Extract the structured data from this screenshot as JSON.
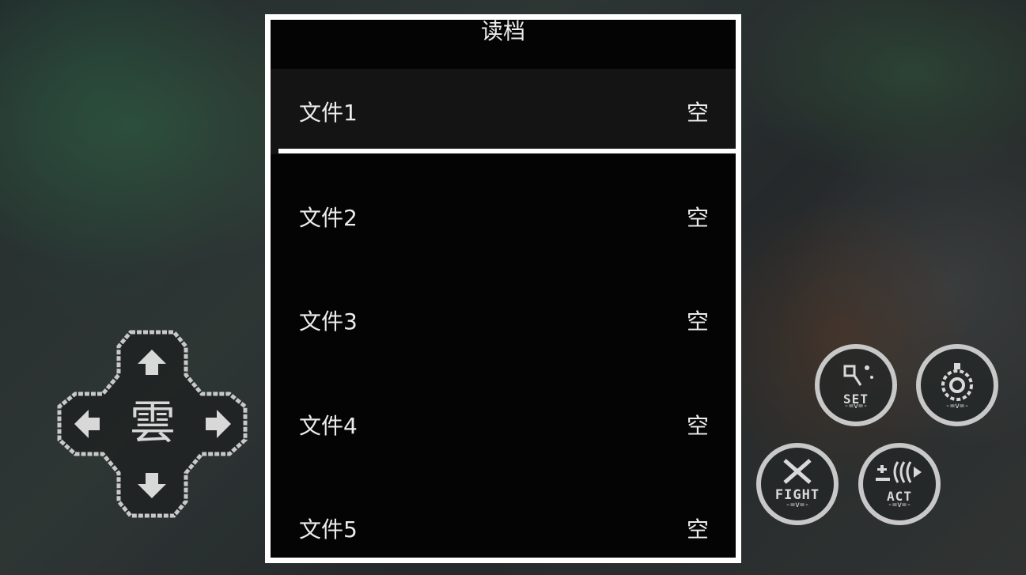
{
  "dialog": {
    "title": "读档",
    "slots": [
      {
        "name": "文件1",
        "status": "空",
        "selected": true
      },
      {
        "name": "文件2",
        "status": "空"
      },
      {
        "name": "文件3",
        "status": "空"
      },
      {
        "name": "文件4",
        "status": "空"
      },
      {
        "name": "文件5",
        "status": "空"
      }
    ]
  },
  "dpad": {
    "center_label": "雲",
    "icons": [
      "arrow-up-icon",
      "arrow-down-icon",
      "arrow-left-icon",
      "arrow-right-icon"
    ]
  },
  "buttons": {
    "set": {
      "label": "SET",
      "icon": "map-pin-icon"
    },
    "menu": {
      "icon": "gear-icon"
    },
    "fight": {
      "label": "FIGHT",
      "icon": "crossed-swords-icon"
    },
    "act": {
      "label": "ACT",
      "icon": "talk-icon"
    }
  },
  "colors": {
    "panel": "#040404",
    "border": "#ffffff",
    "text": "#ececec",
    "selected_row": "#141414"
  }
}
